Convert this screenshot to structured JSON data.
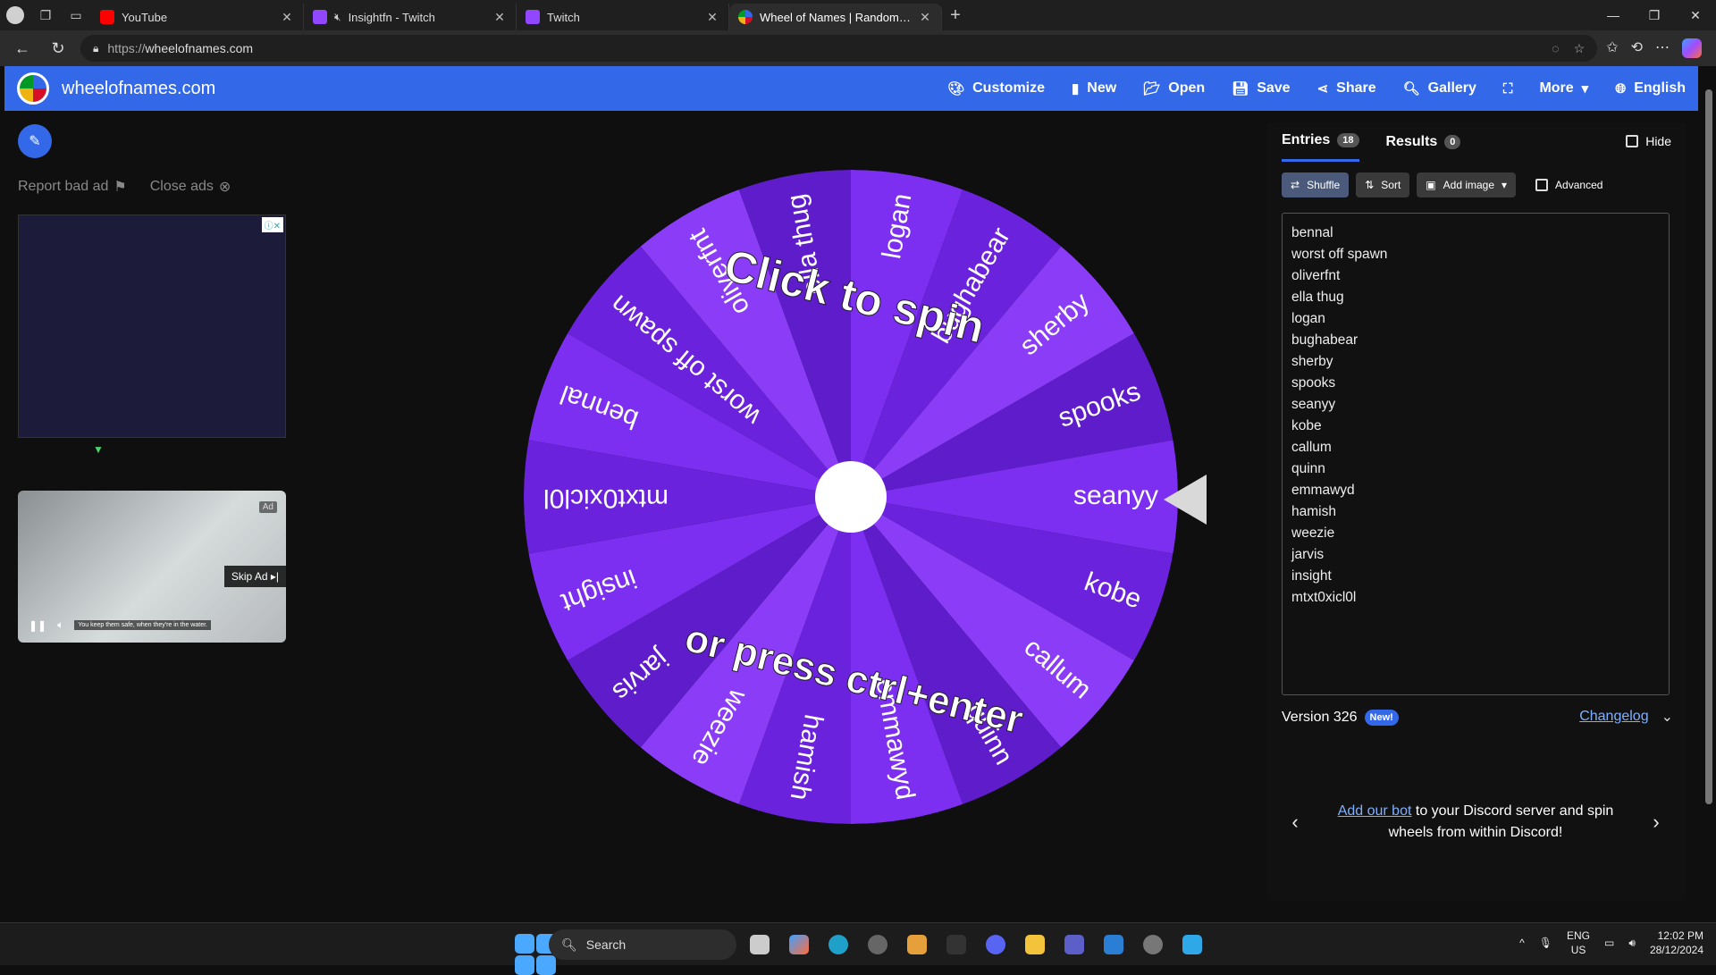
{
  "browser": {
    "tabs": [
      {
        "title": "YouTube",
        "fav_color": "#ff0000"
      },
      {
        "title": "Insightfn - Twitch",
        "fav_color": "#9146ff"
      },
      {
        "title": "Twitch",
        "fav_color": "#9146ff"
      },
      {
        "title": "Wheel of Names | Random name",
        "fav_color": "#3369e8"
      }
    ],
    "url_scheme": "https://",
    "url_host": "wheelofnames.com"
  },
  "app": {
    "brand": "wheelofnames.com",
    "menu": {
      "customize": "Customize",
      "new": "New",
      "open": "Open",
      "save": "Save",
      "share": "Share",
      "gallery": "Gallery",
      "more": "More",
      "language": "English"
    }
  },
  "ads": {
    "report": "Report bad ad",
    "close": "Close ads",
    "ad_label": "Ad",
    "skip": "Skip Ad",
    "caption": "You keep them safe, when they're in the water."
  },
  "wheel": {
    "line1": "Click to spin",
    "line2": "or press ctrl+enter",
    "slice_color": "#7c2ff0",
    "segments": [
      "bennal",
      "worst off spawn",
      "oliverfnt",
      "ella thug",
      "logan",
      "bughabear",
      "sherby",
      "spooks",
      "seanyy",
      "kobe",
      "callum",
      "quinn",
      "emmawyd",
      "hamish",
      "weezie",
      "jarvis",
      "insight",
      "mtxt0xicl0l"
    ]
  },
  "panel": {
    "tab_entries": "Entries",
    "entries_count": "18",
    "tab_results": "Results",
    "results_count": "0",
    "hide": "Hide",
    "shuffle": "Shuffle",
    "sort": "Sort",
    "add_image": "Add image",
    "advanced": "Advanced",
    "entries": [
      "bennal",
      "worst off spawn",
      "oliverfnt",
      "ella thug",
      "logan",
      "bughabear",
      "sherby",
      "spooks",
      "seanyy",
      "kobe",
      "callum",
      "quinn",
      "emmawyd",
      "hamish",
      "weezie",
      "jarvis",
      "insight",
      "mtxt0xicl0l"
    ],
    "version": "Version 326",
    "new_badge": "New!",
    "changelog": "Changelog",
    "discord_link": "Add our bot",
    "discord_text_1": " to your Discord server and spin",
    "discord_text_2": "wheels from within Discord!"
  },
  "taskbar": {
    "search": "Search",
    "lang_top": "ENG",
    "lang_bottom": "US",
    "time": "12:02 PM",
    "date": "28/12/2024"
  }
}
